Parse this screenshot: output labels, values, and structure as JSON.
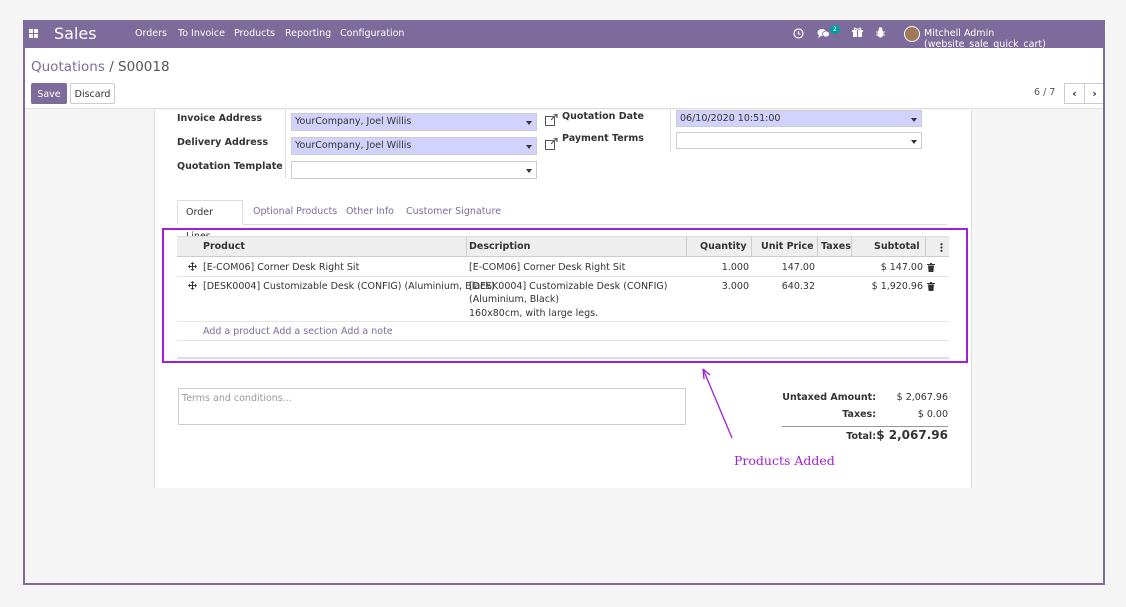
{
  "navbar": {
    "brand": "Sales",
    "menu": [
      "Orders",
      "To Invoice",
      "Products",
      "Reporting",
      "Configuration"
    ],
    "chat_badge": "2",
    "user": "Mitchell Admin (website_sale_quick_cart)",
    "color": "#7c6b9b"
  },
  "breadcrumb": {
    "parent": "Quotations",
    "separator": " / ",
    "current": "S00018"
  },
  "buttons": {
    "save": "Save",
    "discard": "Discard"
  },
  "pager": {
    "value": "6 / 7"
  },
  "form": {
    "invoice_address": {
      "label": "Invoice Address",
      "value": "YourCompany, Joel Willis"
    },
    "delivery_address": {
      "label": "Delivery Address",
      "value": "YourCompany, Joel Willis"
    },
    "quotation_template": {
      "label": "Quotation Template",
      "value": ""
    },
    "quotation_date": {
      "label": "Quotation Date",
      "value": "06/10/2020 10:51:00"
    },
    "payment_terms": {
      "label": "Payment Terms",
      "value": ""
    }
  },
  "tabs": [
    "Order Lines",
    "Optional Products",
    "Other Info",
    "Customer Signature"
  ],
  "table": {
    "headers": {
      "product": "Product",
      "description": "Description",
      "quantity": "Quantity",
      "unit_price": "Unit Price",
      "taxes": "Taxes",
      "subtotal": "Subtotal"
    },
    "rows": [
      {
        "product": "[E-COM06] Corner Desk Right Sit",
        "description_1": "[E-COM06] Corner Desk Right Sit",
        "description_2": "",
        "description_3": "",
        "quantity": "1.000",
        "unit_price": "147.00",
        "taxes": "",
        "subtotal": "$ 147.00"
      },
      {
        "product": "[DESK0004] Customizable Desk (CONFIG) (Aluminium, Black)",
        "description_1": "[DESK0004] Customizable Desk (CONFIG)",
        "description_2": "(Aluminium, Black)",
        "description_3": "160x80cm, with large legs.",
        "quantity": "3.000",
        "unit_price": "640.32",
        "taxes": "",
        "subtotal": "$ 1,920.96"
      }
    ],
    "add_product": "Add a product",
    "add_section": "Add a section",
    "add_note": "Add a note"
  },
  "terms_placeholder": "Terms and conditions...",
  "totals": {
    "untaxed_label": "Untaxed Amount:",
    "untaxed_value": "$ 2,067.96",
    "taxes_label": "Taxes:",
    "taxes_value": "$ 0.00",
    "total_label": "Total:",
    "total_value": "$ 2,067.96"
  },
  "annotation": {
    "text": "Products Added",
    "color": "#a020d8"
  }
}
